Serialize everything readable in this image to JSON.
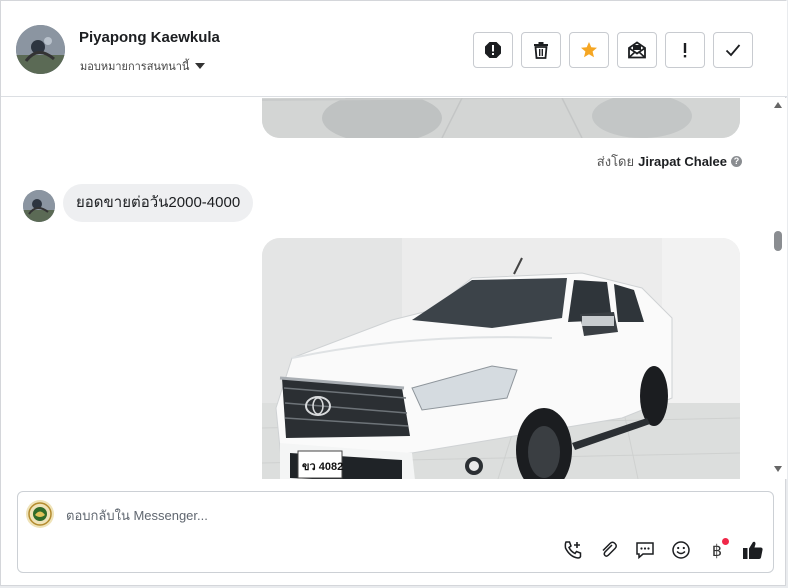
{
  "header": {
    "contact_name": "Piyapong Kaewkula",
    "assign_label": "มอบหมายการสนทนานี้",
    "actions": [
      "spam-icon",
      "delete-icon",
      "star-icon",
      "mark-unread-icon",
      "important-icon",
      "done-icon"
    ],
    "star_color": "#f5a623"
  },
  "thread": {
    "sent_by_prefix": "ส่งโดย",
    "sent_by_name": "Jirapat Chalee",
    "incoming_message": "ยอดขายต่อวัน2000-4000",
    "car_plate": "ขว 4082"
  },
  "composer": {
    "placeholder": "ตอบกลับใน Messenger...",
    "tools": [
      "call-add-icon",
      "attach-icon",
      "saved-reply-icon",
      "emoji-icon",
      "baht-icon",
      "like-icon"
    ],
    "baht_symbol": "฿"
  }
}
